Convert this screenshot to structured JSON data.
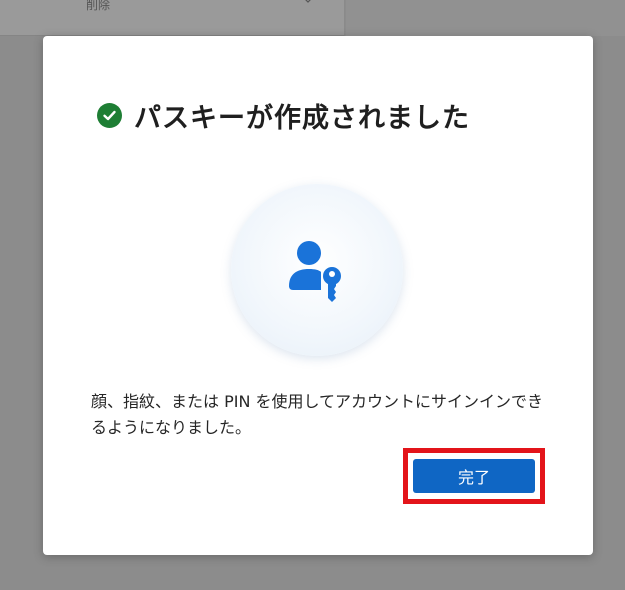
{
  "background": {
    "menu_label": "削除",
    "chevron_icon": "chevron-down-icon"
  },
  "dialog": {
    "status_icon": "check-circle-icon",
    "title": "パスキーが作成されました",
    "illustration_icon": "user-key-icon",
    "message": "顔、指紋、または PIN を使用してアカウントにサインインできるようになりました。",
    "done_label": "完了"
  },
  "colors": {
    "success": "#1e7e34",
    "primary": "#0f66c4",
    "highlight": "#e3141a"
  }
}
